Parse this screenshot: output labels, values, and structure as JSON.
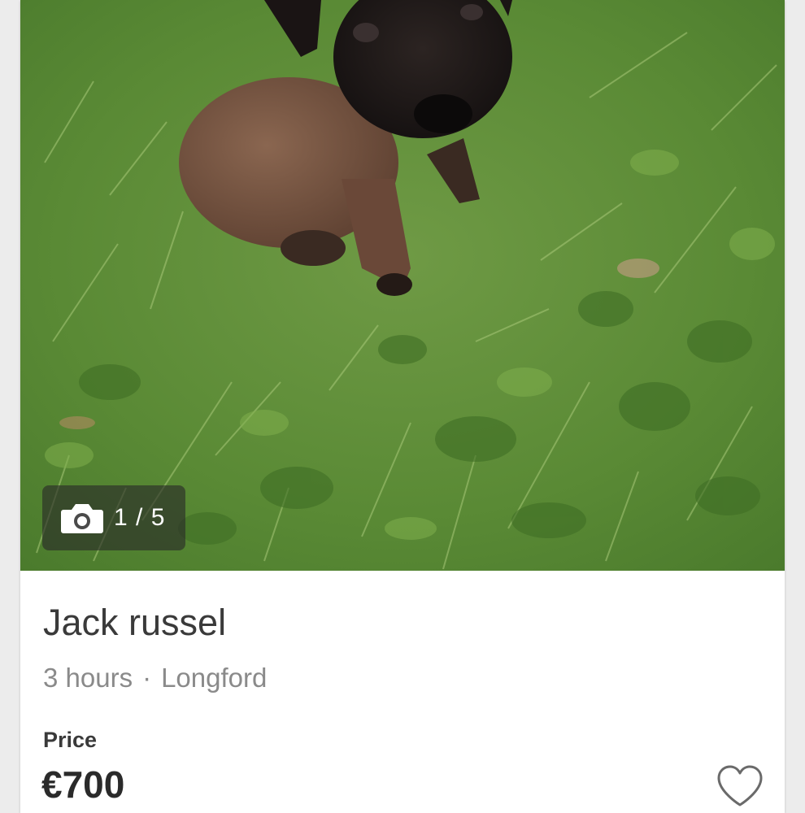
{
  "listing": {
    "photo_alt": "puppy-photo",
    "photo_counter": "1 / 5",
    "title": "Jack russel",
    "time_posted": "3 hours",
    "separator": "·",
    "location": "Longford",
    "price_label": "Price",
    "price": "€700"
  },
  "icons": {
    "camera": "camera-icon",
    "favorite": "heart-outline-icon"
  },
  "colors": {
    "title": "#3a3a3a",
    "meta": "#8a8a8a",
    "counter_bg": "rgba(40,40,40,0.62)"
  }
}
